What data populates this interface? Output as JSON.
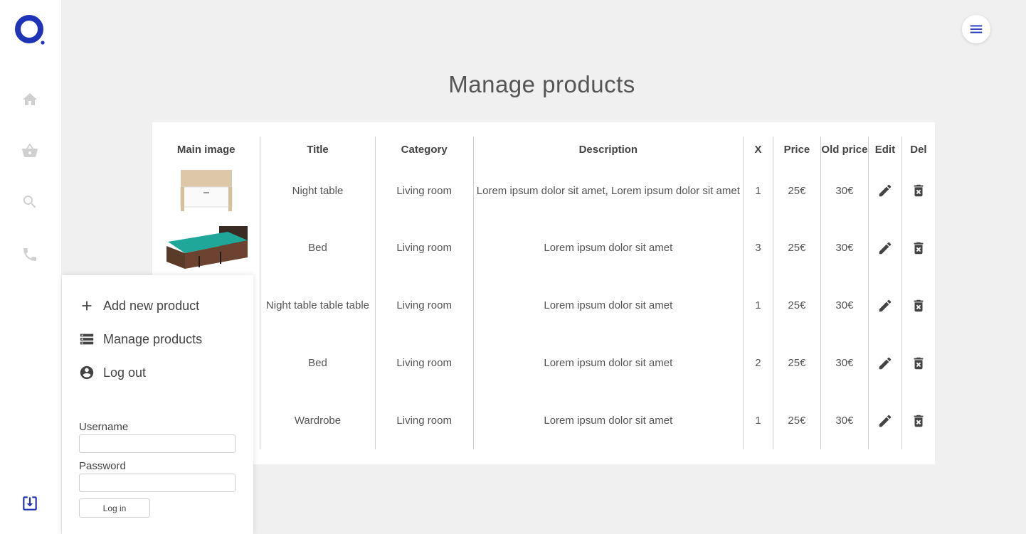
{
  "app": {
    "brand_color": "#1e33b8",
    "logo_icon": "logo-ring-icon"
  },
  "sidebar": {
    "items": [
      {
        "name": "home",
        "icon": "home-icon"
      },
      {
        "name": "shop",
        "icon": "basket-icon"
      },
      {
        "name": "search",
        "icon": "search-icon"
      },
      {
        "name": "contact",
        "icon": "phone-icon"
      }
    ],
    "bottom_icon": "download-box-icon"
  },
  "header": {
    "menu_icon": "hamburger-icon"
  },
  "main": {
    "title": "Manage products",
    "table": {
      "columns": [
        "Main image",
        "Title",
        "Category",
        "Description",
        "X",
        "Price",
        "Old price",
        "Edit",
        "Del"
      ],
      "rows": [
        {
          "image": "night-table",
          "title": "Night table",
          "category": "Living room",
          "description": "Lorem ipsum dolor sit amet, Lorem ipsum dolor sit amet",
          "qty": "1",
          "price": "25€",
          "old_price": "30€"
        },
        {
          "image": "bed",
          "title": "Bed",
          "category": "Living room",
          "description": "Lorem ipsum dolor sit amet",
          "qty": "3",
          "price": "25€",
          "old_price": "30€"
        },
        {
          "image": "",
          "title": "Night table table table",
          "category": "Living room",
          "description": "Lorem ipsum dolor sit amet",
          "qty": "1",
          "price": "25€",
          "old_price": "30€"
        },
        {
          "image": "",
          "title": "Bed",
          "category": "Living room",
          "description": "Lorem ipsum dolor sit amet",
          "qty": "2",
          "price": "25€",
          "old_price": "30€"
        },
        {
          "image": "",
          "title": "Wardrobe",
          "category": "Living room",
          "description": "Lorem ipsum dolor sit amet",
          "qty": "1",
          "price": "25€",
          "old_price": "30€"
        }
      ]
    }
  },
  "popup_menu": {
    "items": [
      {
        "label": "Add new product",
        "icon": "plus-icon"
      },
      {
        "label": "Manage products",
        "icon": "list-icon"
      },
      {
        "label": "Log out",
        "icon": "account-circle-icon"
      }
    ],
    "username_label": "Username",
    "username_value": "",
    "password_label": "Password",
    "password_value": "",
    "login_button": "Log in"
  }
}
